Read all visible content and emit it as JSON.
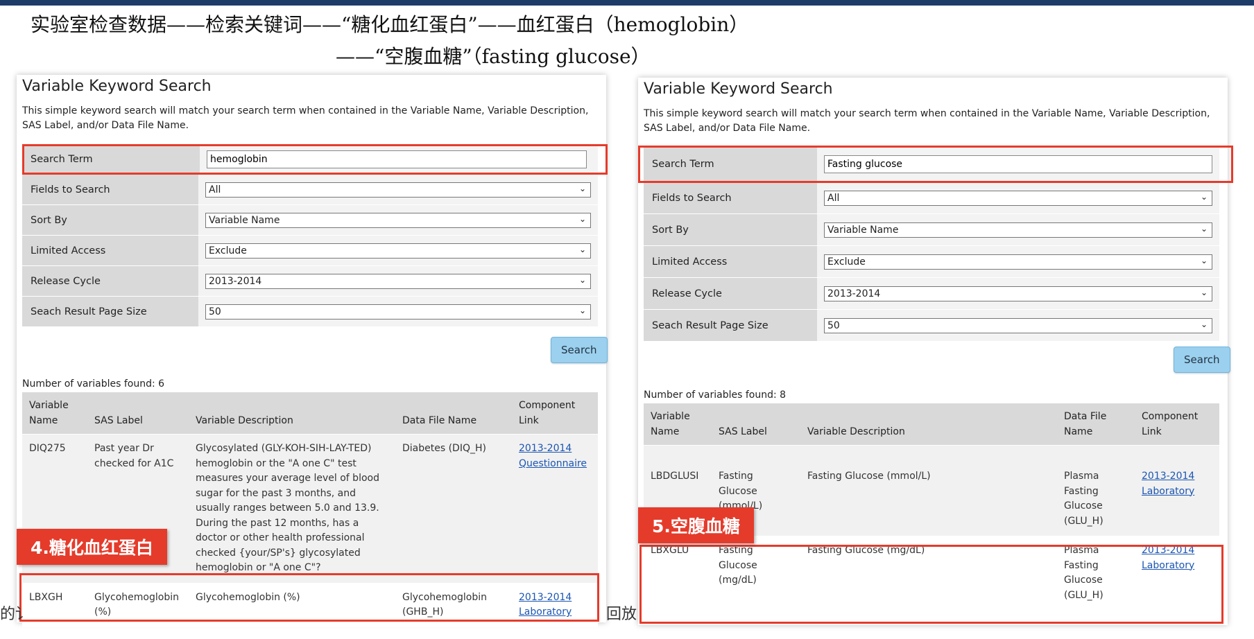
{
  "slide": {
    "title_line1": "实验室检查数据——检索关键词——“糖化血红蛋白”——血红蛋白（hemoglobin）",
    "title_line2": "——“空腹血糖”（fasting glucose）",
    "stray_left": "的讠",
    "stray_mid": "回放"
  },
  "left_panel": {
    "heading": "Variable Keyword Search",
    "description": "This simple keyword search will match your search term when contained in the Variable Name, Variable Description, SAS Label, and/or Data File Name.",
    "form": {
      "search_term_label": "Search Term",
      "search_term_value": "hemoglobin",
      "fields_label": "Fields to Search",
      "fields_value": "All",
      "sort_label": "Sort By",
      "sort_value": "Variable Name",
      "access_label": "Limited Access",
      "access_value": "Exclude",
      "cycle_label": "Release Cycle",
      "cycle_value": "2013-2014",
      "pagesize_label": "Seach Result Page Size",
      "pagesize_value": "50"
    },
    "search_button": "Search",
    "found_text": "Number of variables found: 6",
    "columns": [
      "Variable Name",
      "SAS Label",
      "Variable Description",
      "Data File Name",
      "Component Link"
    ],
    "rows": [
      {
        "name": "DIQ275",
        "sas": "Past year Dr checked for A1C",
        "desc": "Glycosylated (GLY-KOH-SIH-LAY-TED) hemoglobin or the \"A one C\" test measures your average level of blood sugar for the past 3 months, and usually ranges between 5.0 and 13.9. During the past 12 months, has a doctor or other health professional checked {your/SP's} glycosylated hemoglobin or \"A one C\"?",
        "file": "Diabetes (DIQ_H)",
        "link": "2013-2014 Questionnaire"
      },
      {
        "name": "LBXGH",
        "sas": "Glycohemoglobin (%)",
        "desc": "Glycohemoglobin (%)",
        "file": "Glycohemoglobin (GHB_H)",
        "link": "2013-2014 Laboratory"
      }
    ],
    "tag": "4.糖化血红蛋白"
  },
  "right_panel": {
    "heading": "Variable Keyword Search",
    "description": "This simple keyword search will match your search term when contained in the Variable Name, Variable Description, SAS Label, and/or Data File Name.",
    "form": {
      "search_term_label": "Search Term",
      "search_term_value": "Fasting glucose",
      "fields_label": "Fields to Search",
      "fields_value": "All",
      "sort_label": "Sort By",
      "sort_value": "Variable Name",
      "access_label": "Limited Access",
      "access_value": "Exclude",
      "cycle_label": "Release Cycle",
      "cycle_value": "2013-2014",
      "pagesize_label": "Seach Result Page Size",
      "pagesize_value": "50"
    },
    "search_button": "Search",
    "found_text": "Number of variables found: 8",
    "columns": [
      "Variable Name",
      "SAS Label",
      "Variable Description",
      "Data File Name",
      "Component Link"
    ],
    "rows": [
      {
        "name": "LBDGLUSI",
        "sas": "Fasting Glucose (mmol/L)",
        "desc": "Fasting Glucose (mmol/L)",
        "file": "Plasma Fasting Glucose (GLU_H)",
        "link": "2013-2014 Laboratory"
      },
      {
        "name": "LBXGLU",
        "sas": "Fasting Glucose (mg/dL)",
        "desc": "Fasting Glucose (mg/dL)",
        "file": "Plasma Fasting Glucose (GLU_H)",
        "link": "2013-2014 Laboratory"
      }
    ],
    "tag": "5.空腹血糖"
  },
  "colors": {
    "highlight": "#e53b2b",
    "button": "#9bd0ee",
    "label_bg": "#d9d9d9",
    "topbar": "#1f3c68",
    "link": "#1a55b3"
  }
}
